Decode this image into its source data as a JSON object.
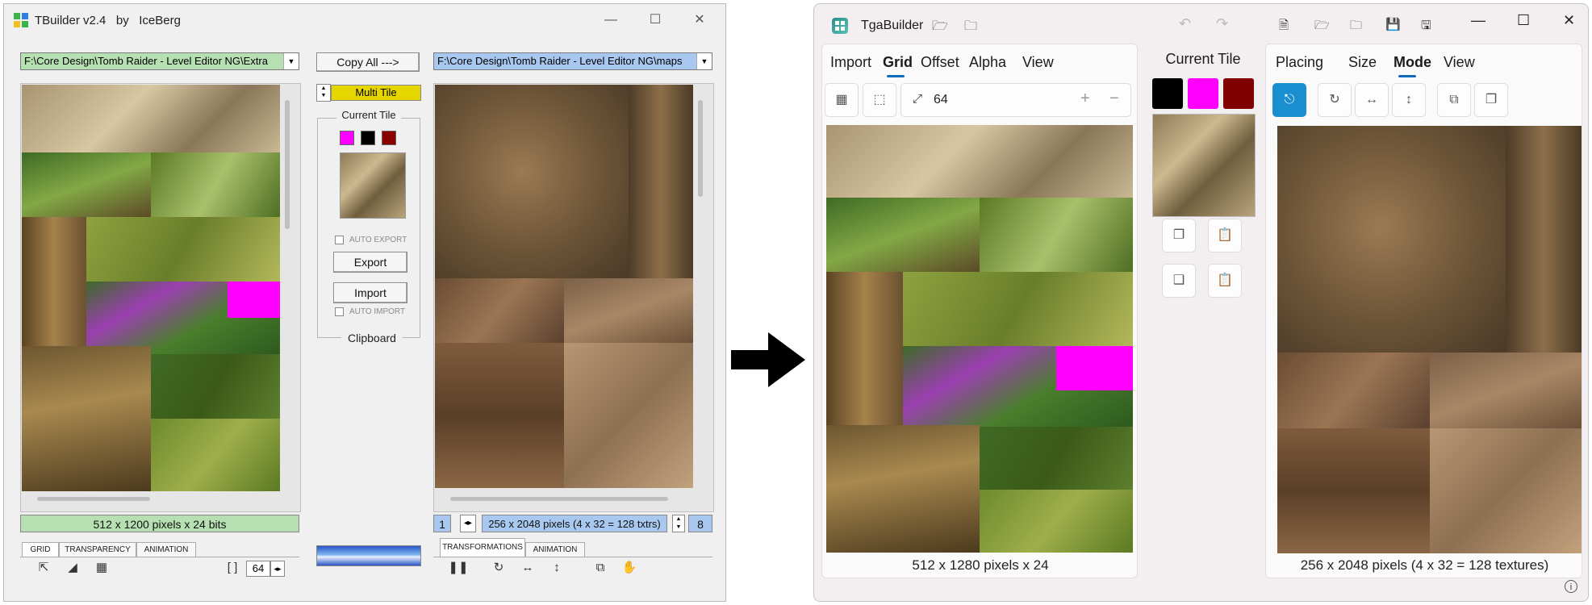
{
  "old_app": {
    "title": "TBuilder v2.4",
    "by": "by",
    "author": "IceBerg",
    "left_path": "F:\\Core Design\\Tomb Raider - Level Editor NG\\Extra",
    "right_path": "F:\\Core Design\\Tomb Raider - Level Editor NG\\maps",
    "copy_all": "Copy All --->",
    "multi_tile": "Multi Tile",
    "current_tile": "Current Tile",
    "auto_export": "AUTO EXPORT",
    "export": "Export",
    "import": "Import",
    "auto_import": "AUTO IMPORT",
    "clipboard": "Clipboard",
    "left_status": "512 x 1200 pixels x 24 bits",
    "right_page": "1",
    "right_status": "256 x 2048 pixels (4 x 32 = 128 txtrs)",
    "right_count": "8",
    "grid_size": "64",
    "tabs_left": [
      "GRID",
      "TRANSPARENCY",
      "ANIMATION"
    ],
    "tabs_right": [
      "TRANSFORMATIONS",
      "ANIMATION"
    ],
    "swatches": [
      "#ff00ff",
      "#000000",
      "#8b0000"
    ]
  },
  "new_app": {
    "title": "TgaBuilder",
    "left_menu": [
      "Import",
      "Grid",
      "Offset",
      "Alpha",
      "View"
    ],
    "grid_size": "64",
    "current_tile": "Current Tile",
    "swatches": [
      "#000000",
      "#ff00ff",
      "#800000"
    ],
    "right_menu": [
      "Placing",
      "Size",
      "Mode",
      "View"
    ],
    "left_status": "512 x 1280 pixels x 24",
    "right_status": "256 x 2048 pixels (4 x 32 = 128 textures)"
  }
}
